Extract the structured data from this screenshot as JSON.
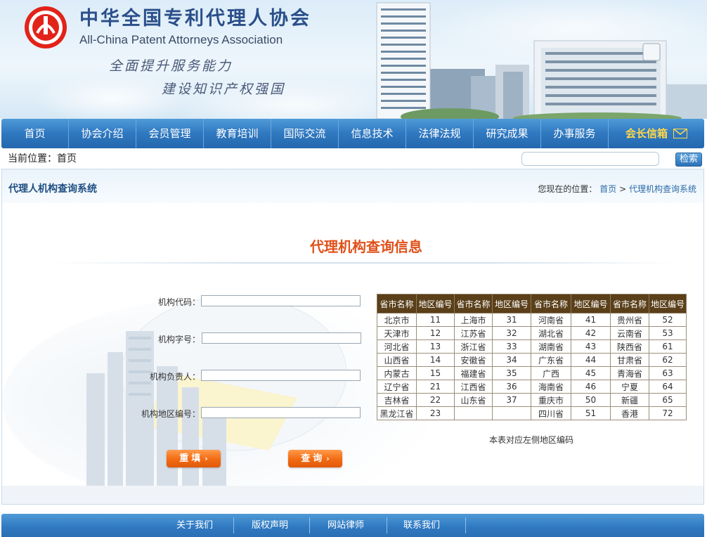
{
  "header": {
    "title_cn": "中华全国专利代理人协会",
    "title_en": "All-China Patent Attorneys Association",
    "slogan_1": "全面提升服务能力",
    "slogan_2": "建设知识产权强国"
  },
  "nav": {
    "items": [
      "首页",
      "协会介绍",
      "会员管理",
      "教育培训",
      "国际交流",
      "信息技术",
      "法律法规",
      "研究成果",
      "办事服务"
    ],
    "mailbox_label": "会长信箱"
  },
  "location_bar": {
    "current_location": "当前位置：首页",
    "search_value": "",
    "search_button": "检索"
  },
  "panel": {
    "system_title": "代理人机构查询系统",
    "breadcrumb_prefix": "您现在的位置：",
    "breadcrumb_home": "首页",
    "breadcrumb_sep": ">",
    "breadcrumb_current": "代理机构查询系统",
    "query_title": "代理机构查询信息"
  },
  "form": {
    "fields": [
      {
        "label": "机构代码：",
        "value": ""
      },
      {
        "label": "机构字号：",
        "value": ""
      },
      {
        "label": "机构负责人：",
        "value": ""
      },
      {
        "label": "机构地区编号：",
        "value": ""
      }
    ],
    "reset_label": "重填",
    "submit_label": "查询",
    "button_arrow": "›"
  },
  "region_table": {
    "headers": [
      "省市名称",
      "地区编号",
      "省市名称",
      "地区编号",
      "省市名称",
      "地区编号",
      "省市名称",
      "地区编号"
    ],
    "rows": [
      [
        "北京市",
        "11",
        "上海市",
        "31",
        "河南省",
        "41",
        "贵州省",
        "52"
      ],
      [
        "天津市",
        "12",
        "江苏省",
        "32",
        "湖北省",
        "42",
        "云南省",
        "53"
      ],
      [
        "河北省",
        "13",
        "浙江省",
        "33",
        "湖南省",
        "43",
        "陕西省",
        "61"
      ],
      [
        "山西省",
        "14",
        "安徽省",
        "34",
        "广东省",
        "44",
        "甘肃省",
        "62"
      ],
      [
        "内蒙古",
        "15",
        "福建省",
        "35",
        "广西",
        "45",
        "青海省",
        "63"
      ],
      [
        "辽宁省",
        "21",
        "江西省",
        "36",
        "海南省",
        "46",
        "宁夏",
        "64"
      ],
      [
        "吉林省",
        "22",
        "山东省",
        "37",
        "重庆市",
        "50",
        "新疆",
        "65"
      ],
      [
        "黑龙江省",
        "23",
        "",
        "",
        "四川省",
        "51",
        "香港",
        "72"
      ]
    ],
    "note": "本表对应左侧地区编码"
  },
  "footer": {
    "links": [
      "关于我们",
      "版权声明",
      "网站律师",
      "联系我们"
    ]
  },
  "colors": {
    "nav_blue": "#2f78c0",
    "accent_orange": "#e0501a",
    "table_header": "#5a3f19",
    "mailbox_yellow": "#ffd84a"
  },
  "icons": [
    "association-logo-icon",
    "mail-icon",
    "arrow-right-icon"
  ]
}
